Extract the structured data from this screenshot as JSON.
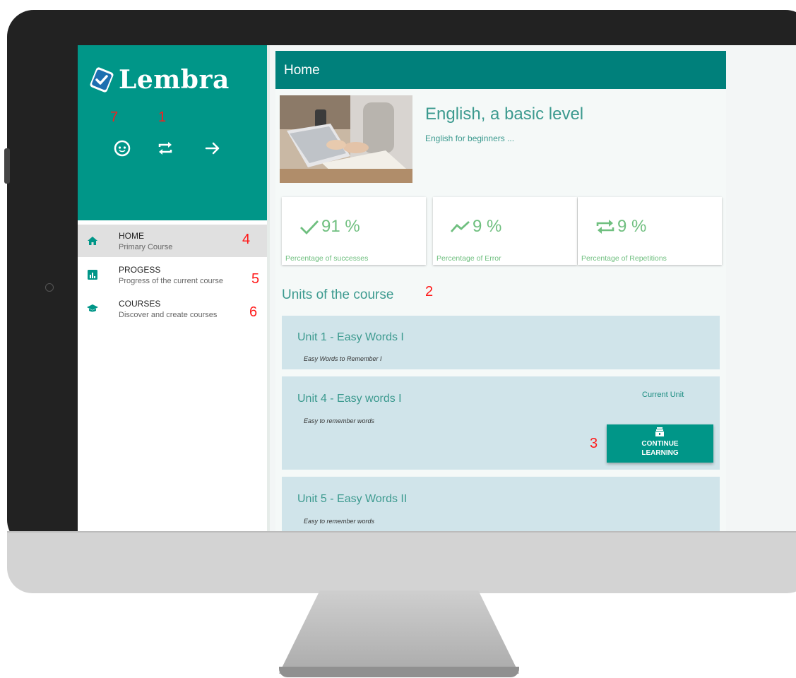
{
  "sidebar": {
    "brand": "Lembra",
    "header_icons": [
      {
        "icon": "face-icon",
        "number": "7"
      },
      {
        "icon": "repeat-icon",
        "number": "1"
      },
      {
        "icon": "arrow-right-icon",
        "number": ""
      }
    ],
    "nav": [
      {
        "title": "HOME",
        "subtitle": "Primary Course",
        "icon": "home-icon",
        "number": "4",
        "active": true
      },
      {
        "title": "PROGESS",
        "subtitle": "Progress of the current course",
        "icon": "chart-icon",
        "number": "5",
        "active": false
      },
      {
        "title": "COURSES",
        "subtitle": "Discover and create courses",
        "icon": "school-icon",
        "number": "6",
        "active": false
      }
    ]
  },
  "main": {
    "header_title": "Home",
    "course": {
      "title": "English, a basic level",
      "subtitle": "English for beginners ..."
    },
    "stats": [
      {
        "value": "91 %",
        "label": "Percentage of successes",
        "icon": "check-icon"
      },
      {
        "value": "9 %",
        "label": "Percentage of Error",
        "icon": "trend-icon"
      },
      {
        "value": "9 %",
        "label": "Percentage of Repetitions",
        "icon": "repeat-icon"
      }
    ],
    "units_title": "Units of the course",
    "units_number": "2",
    "units": [
      {
        "title": "Unit 1 - Easy Words I",
        "subtitle": "Easy Words to Remember I"
      },
      {
        "title": "Unit 4 - Easy words I",
        "subtitle": "Easy to remember words",
        "badge": "Current Unit",
        "button_line1": "CONTINUE",
        "button_line2": "LEARNING",
        "button_number": "3"
      },
      {
        "title": "Unit 5 - Easy Words II",
        "subtitle": "Easy to remember words"
      }
    ]
  },
  "colors": {
    "accent": "#009688",
    "header": "#00807b",
    "text_teal": "#3c9a8f",
    "stat_green": "#6fbf7f",
    "unit_bg": "#d0e4ea",
    "annotation_red": "#ff1a1a"
  }
}
